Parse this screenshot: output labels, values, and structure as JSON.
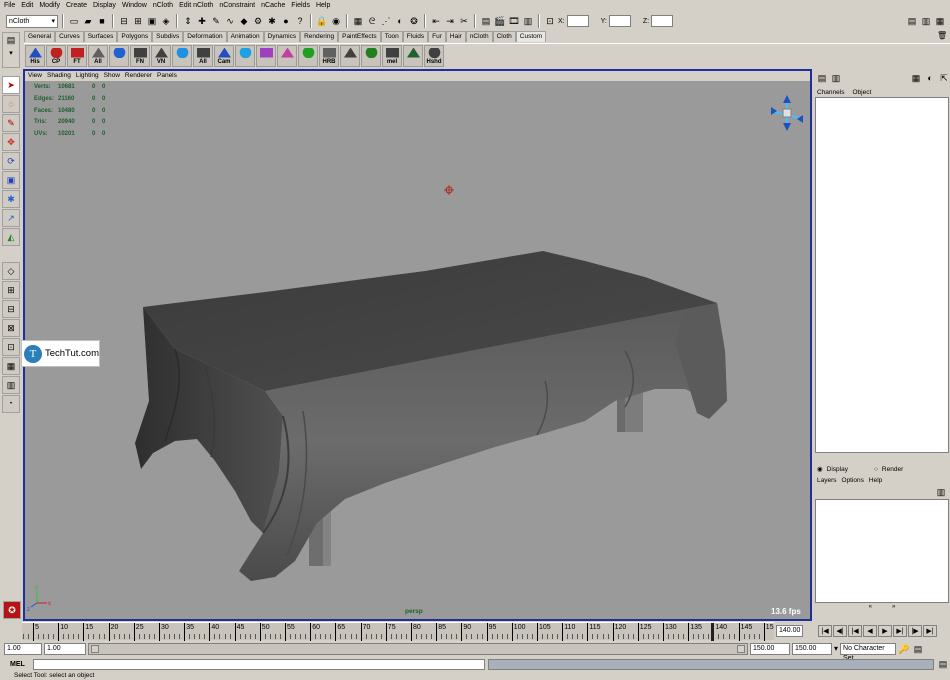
{
  "menubar": [
    "File",
    "Edit",
    "Modify",
    "Create",
    "Display",
    "Window",
    "nCloth",
    "Edit nCloth",
    "nConstraint",
    "nCache",
    "Fields",
    "Help"
  ],
  "status": {
    "menuset": "nCloth",
    "x_label": "X:",
    "y_label": "Y:",
    "z_label": "Z:"
  },
  "shelf_tabs": [
    "General",
    "Curves",
    "Surfaces",
    "Polygons",
    "Subdivs",
    "Deformation",
    "Animation",
    "Dynamics",
    "Rendering",
    "PaintEffects",
    "Toon",
    "Fluids",
    "Fur",
    "Hair",
    "nCloth",
    "Cloth",
    "Custom"
  ],
  "shelf_icons": [
    "His",
    "CP",
    "FT",
    "All",
    "",
    "FN",
    "VN",
    "",
    "All",
    "Cam",
    "",
    "",
    "",
    "",
    "HRB",
    "",
    "",
    "mel",
    "",
    "Hshd"
  ],
  "viewport": {
    "menu": [
      "View",
      "Shading",
      "Lighting",
      "Show",
      "Renderer",
      "Panels"
    ],
    "hud": [
      {
        "label": "Verts:",
        "value": "10681",
        "a": "0",
        "b": "0"
      },
      {
        "label": "Edges:",
        "value": "21160",
        "a": "0",
        "b": "0"
      },
      {
        "label": "Faces:",
        "value": "10480",
        "a": "0",
        "b": "0"
      },
      {
        "label": "Tris:",
        "value": "20940",
        "a": "0",
        "b": "0"
      },
      {
        "label": "UVs:",
        "value": "10201",
        "a": "0",
        "b": "0"
      }
    ],
    "camera": "persp",
    "fps": "13.6 fps"
  },
  "watermark": {
    "text": "TechTut.com",
    "logo_letter": "T"
  },
  "channelbox": {
    "menu": [
      "Channels",
      "Object"
    ]
  },
  "layers": {
    "display": "Display",
    "render": "Render",
    "menu": [
      "Layers",
      "Options",
      "Help"
    ]
  },
  "timeline": {
    "ticks": [
      "5",
      "10",
      "15",
      "20",
      "25",
      "30",
      "35",
      "40",
      "45",
      "50",
      "55",
      "60",
      "65",
      "70",
      "75",
      "80",
      "85",
      "90",
      "95",
      "100",
      "105",
      "110",
      "115",
      "120",
      "125",
      "130",
      "135",
      "140",
      "145",
      "15"
    ],
    "current_frame": "140.00"
  },
  "range": {
    "start": "1.00",
    "playback_start": "1.00",
    "playback_end": "150.00",
    "end": "150.00",
    "character_set": "No Character Set"
  },
  "command": {
    "label": "MEL"
  },
  "help": {
    "text": "Select Tool: select an object"
  },
  "colors": {
    "viewport_bg": "#9a9a9a",
    "viewport_border": "#1f2f9a",
    "hud_text": "#1e5f2c",
    "ui_gray": "#d4d0c8"
  }
}
